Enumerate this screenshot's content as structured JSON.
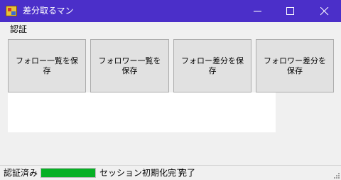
{
  "window": {
    "title": "差分取るマン",
    "controls": [
      "minimize",
      "maximize",
      "close"
    ]
  },
  "menu": {
    "items": [
      "認証"
    ]
  },
  "actions": {
    "save_following": "フォロー一覧を保存",
    "save_followers": "フォロワー一覧を保存",
    "save_following_diff": "フォロー差分を保存",
    "save_followers_diff": "フォロワー差分を保存"
  },
  "status": {
    "auth_state": "認証済み",
    "progress_percent": 100,
    "progress_color": "#06b025",
    "session_message": "セッション初期化完了",
    "completion": "完了"
  },
  "colors": {
    "titlebar": "#4b2fc9",
    "window_bg": "#f0f0f0",
    "button_face": "#e1e1e1"
  },
  "icons": [
    "app-icon",
    "minimize-icon",
    "maximize-icon",
    "close-icon",
    "resize-grip-icon"
  ]
}
